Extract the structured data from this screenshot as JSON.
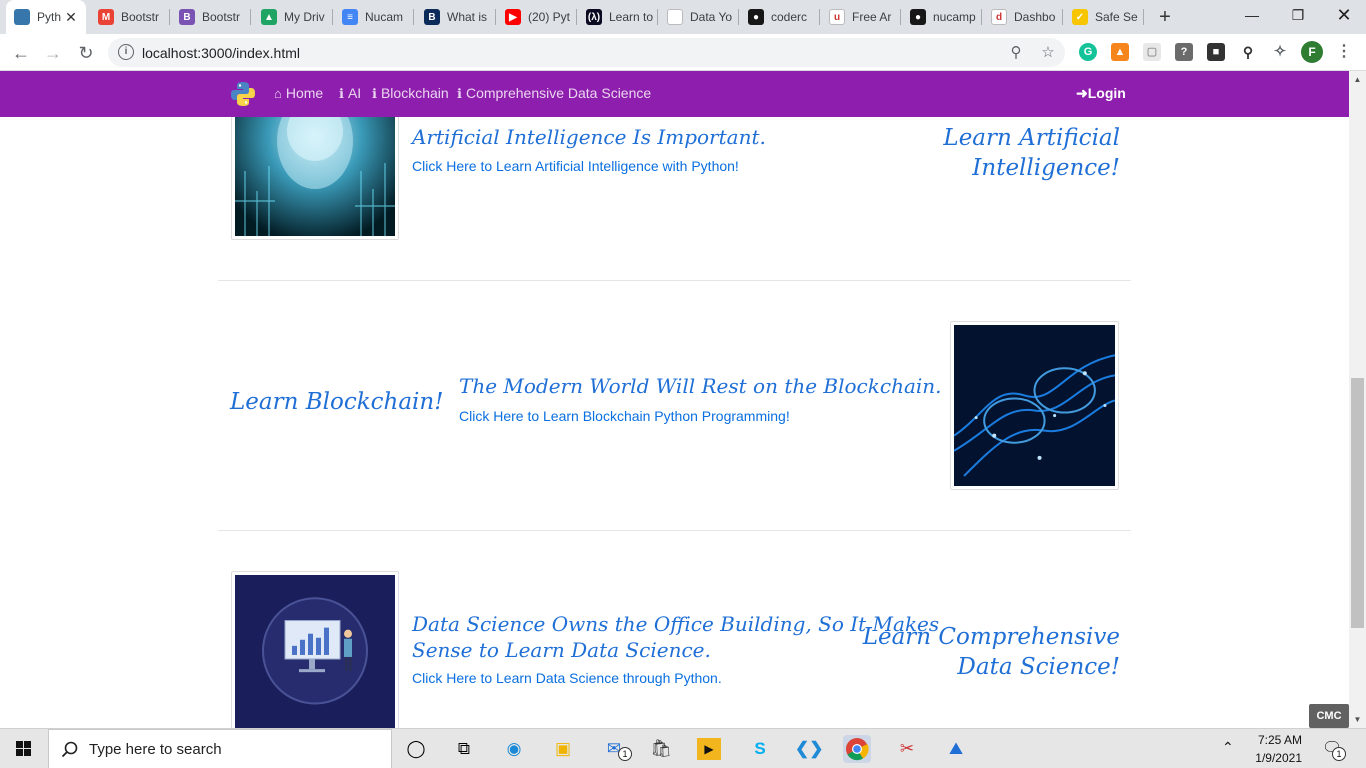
{
  "browser": {
    "tabs": [
      {
        "title": "Pyth",
        "fav": "python-icon",
        "color": "#3776ab",
        "glyph": "",
        "active": true
      },
      {
        "title": "Bootstr",
        "fav": "gmail-icon",
        "color": "#ea4335",
        "glyph": "M"
      },
      {
        "title": "Bootstr",
        "fav": "bootstrap-icon",
        "color": "#7952b3",
        "glyph": "B"
      },
      {
        "title": "My Driv",
        "fav": "google-drive-icon",
        "color": "#1fa463",
        "glyph": "▲"
      },
      {
        "title": "Nucam",
        "fav": "google-docs-icon",
        "color": "#4285f4",
        "glyph": "≡"
      },
      {
        "title": "What is",
        "fav": "b-logo-icon",
        "color": "#0b2b5b",
        "glyph": "B"
      },
      {
        "title": "(20) Pyt",
        "fav": "youtube-icon",
        "color": "#ff0000",
        "glyph": "▶"
      },
      {
        "title": "Learn to",
        "fav": "freecodecamp-icon",
        "color": "#0a0a23",
        "glyph": "(λ)"
      },
      {
        "title": "Data Yo",
        "fav": "blank-page-icon",
        "color": "#ffffff",
        "glyph": ""
      },
      {
        "title": "coderc",
        "fav": "github-icon",
        "color": "#181717",
        "glyph": "●"
      },
      {
        "title": "Free Ar",
        "fav": "udemy-icon",
        "color": "#ffffff",
        "glyph": "u"
      },
      {
        "title": "nucamp",
        "fav": "github-icon",
        "color": "#181717",
        "glyph": "●"
      },
      {
        "title": "Dashbo",
        "fav": "dashboard-icon",
        "color": "#ffffff",
        "glyph": "d"
      },
      {
        "title": "Safe Se",
        "fav": "norton-check-icon",
        "color": "#f7c600",
        "glyph": "✓"
      }
    ],
    "url": "localhost:3000/index.html"
  },
  "site": {
    "brand_icon": "python-logo-icon",
    "nav": {
      "home": "Home",
      "ai": "AI",
      "blockchain": "Blockchain",
      "ds": "Comprehensive Data Science",
      "login": "Login"
    },
    "sections": {
      "ai": {
        "heading": "Artificial Intelligence Is Important.",
        "link": "Click Here to Learn Artificial Intelligence with Python!",
        "side_line1": "Learn Artificial",
        "side_line2": "Intelligence!"
      },
      "blockchain": {
        "side": "Learn Blockchain!",
        "heading": "The Modern World Will Rest on the Blockchain.",
        "link": "Click Here to Learn Blockchain Python Programming!"
      },
      "ds": {
        "heading_line1": "Data Science Owns the Office Building, So It Makes",
        "heading_line2": "Sense to Learn Data Science.",
        "link": "Click Here to Learn Data Science through Python.",
        "side_line1": "Learn Comprehensive",
        "side_line2": "Data Science!"
      }
    },
    "colors": {
      "navbar": "#8e1ead",
      "heading": "#1f6fd6",
      "link": "#0a6fe0"
    }
  },
  "taskbar": {
    "search_placeholder": "Type here to search",
    "time": "7:25 AM",
    "date": "1/9/2021",
    "cmc_label": "CMC",
    "notification_count": "1",
    "mail_badge": "1"
  }
}
